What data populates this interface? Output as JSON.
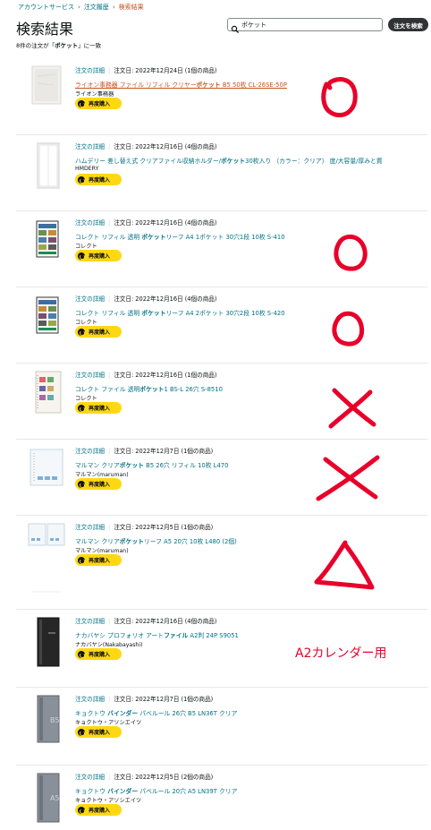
{
  "breadcrumb": [
    "アカウントサービス",
    "注文履歴",
    "検索結果"
  ],
  "page_title": "検索結果",
  "search": {
    "value": "ポケット",
    "button_label": "注文を検索"
  },
  "summary": {
    "prefix": "8件の注文が「",
    "keyword": "ポケット",
    "suffix": "」に一致"
  },
  "detail_label": "注文の詳細",
  "rebuy_label": "再度購入",
  "orders": [
    {
      "date": "注文日: 2022年12月24日 (1個の商品)",
      "title_pre": "ライオン事務器 ファイル リフィル クリヤー",
      "title_kw": "ポケット",
      "title_post": " B5 50枚 CL-26SE-50P",
      "seller": "ライオン事務器"
    },
    {
      "date": "注文日: 2022年12月16日 (4個の商品)",
      "title_pre": "ハムデリー 差し替え式 クリアファイル収納ホルダー/",
      "title_kw": "ポケット",
      "title_post": "30枚入り （カラー：クリア） 度/大容量/厚みと質",
      "seller": "HMDERY"
    },
    {
      "date": "注文日: 2022年12月16日 (4個の商品)",
      "title_pre": "コレクト リフィル 透明 ",
      "title_kw": "ポケット",
      "title_post": "リーフ A4 1ポケット 30穴1段 10枚 S-410",
      "seller": "コレクト"
    },
    {
      "date": "注文日: 2022年12月16日 (4個の商品)",
      "title_pre": "コレクト リフィル 透明 ",
      "title_kw": "ポケット",
      "title_post": "リーフ A4 2ポケット 30穴2段 10枚 S-420",
      "seller": "コレクト"
    },
    {
      "date": "注文日: 2022年12月16日 (1個の商品)",
      "title_pre": "コレクト ファイル 透明",
      "title_kw": "ポケット",
      "title_post": "1 BS-L 26穴 S-8510",
      "seller": "コレクト"
    },
    {
      "date": "注文日: 2022年12月7日 (1個の商品)",
      "title_pre": "マルマン クリア",
      "title_kw": "ポケット",
      "title_post": " B5 26穴 リフィル 10枚 L470",
      "seller": "マルマン(maruman)"
    },
    {
      "date": "注文日: 2022年12月5日 (1個の商品)",
      "title_pre": "マルマン クリア",
      "title_kw": "ポケット",
      "title_post": "リーフ A5 20穴 10枚 L480 (2個)",
      "seller": "マルマン(maruman)"
    },
    {
      "date": "注文日: 2022年12月16日 (4個の商品)",
      "title_pre": "ナカバヤシ プロフォリオ アート",
      "title_kw": "ファイル",
      "title_post": " A2判 24P S9051",
      "seller": "ナカバヤシ(Nakabayashi)"
    },
    {
      "date": "注文日: 2022年12月7日 (1個の商品)",
      "title_pre": "キョクトウ ",
      "title_kw": "バインダー",
      "title_post": " パベルール 26穴 B5 LN36T クリア",
      "seller": "キョクトウ・アソシエイツ"
    },
    {
      "date": "注文日: 2022年12月5日 (2個の商品)",
      "title_pre": "キョクトウ ",
      "title_kw": "バインダー",
      "title_post": " パベルール 20穴 A5 LN39T クリア",
      "seller": "キョクトウ・アソシエイツ"
    }
  ],
  "handwritten": {
    "a2_note": "A2カレンダー用"
  },
  "colors": {
    "link": "#007185",
    "highlight": "#c7511f",
    "button": "#ffd814",
    "annotation": "#e8002a"
  }
}
